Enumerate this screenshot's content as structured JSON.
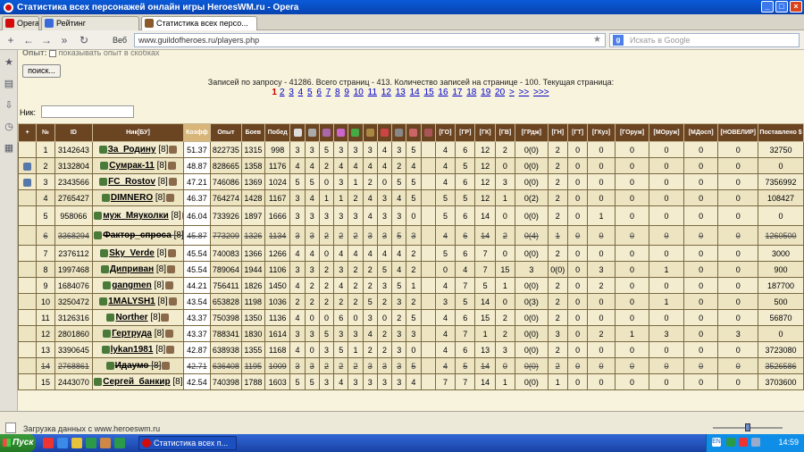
{
  "window": {
    "title": "Статистика всех персонажей онлайн игры HeroesWM.ru - Opera"
  },
  "tabs": [
    {
      "label": "Opera"
    },
    {
      "label": "Рейтинг"
    },
    {
      "label": "Статистика всех персо..."
    }
  ],
  "address": {
    "web_label": "Веб",
    "url": "www.guildofheroes.ru/players.php",
    "search_placeholder": "Искать в Google"
  },
  "page": {
    "option_label": "Опыт:",
    "option_hint": "показывать опыт в скобках",
    "search_button": "поиск...",
    "info": "Записей по запросу - 41286. Всего страниц - 413. Количество записей на странице - 100. Текущая страница:",
    "current_page": "1",
    "pages": [
      "2",
      "3",
      "4",
      "5",
      "6",
      "7",
      "8",
      "9",
      "10",
      "11",
      "12",
      "13",
      "14",
      "15",
      "16",
      "17",
      "18",
      "19",
      "20",
      ">",
      ">>",
      ">>>"
    ],
    "nick_label": "Ник:"
  },
  "table": {
    "headers": [
      "+",
      "№",
      "ID",
      "Ник[БУ]",
      "Коэфф",
      "Опыт",
      "Боев",
      "Побед",
      "",
      "",
      "",
      "",
      "",
      "",
      "",
      "",
      "",
      "",
      "[ГО]",
      "[ГР]",
      "[ГК]",
      "[ГВ]",
      "[ГРдж]",
      "[ГН]",
      "[ГТ]",
      "[ГКуз]",
      "[ГОруж]",
      "[МОруж]",
      "[МДосп]",
      "[НОВЕЛИР]",
      "Поставлено $"
    ],
    "rows": [
      {
        "n": "1",
        "id": "3142643",
        "nick": "За_Родину",
        "lvl": "[8]",
        "k": "51.37",
        "exp": "822735",
        "b": "1315",
        "w": "998",
        "s": [
          "3",
          "3",
          "5",
          "3",
          "3",
          "3",
          "4",
          "3",
          "5"
        ],
        "g": [
          "4",
          "6",
          "12",
          "2",
          "0(0)",
          "2",
          "0",
          "0",
          "0",
          "0",
          "0",
          "0"
        ],
        "p": "32750",
        "strike": false
      },
      {
        "n": "2",
        "id": "3132804",
        "nick": "Сумрак-11",
        "lvl": "[8]",
        "k": "48.87",
        "exp": "828665",
        "b": "1358",
        "w": "1176",
        "s": [
          "4",
          "4",
          "2",
          "4",
          "4",
          "4",
          "4",
          "2",
          "4"
        ],
        "g": [
          "4",
          "5",
          "12",
          "0",
          "0(0)",
          "2",
          "0",
          "0",
          "0",
          "0",
          "0",
          "0"
        ],
        "p": "0",
        "strike": false
      },
      {
        "n": "3",
        "id": "2343566",
        "nick": "FC_Rostov",
        "lvl": "[8]",
        "k": "47.21",
        "exp": "746086",
        "b": "1369",
        "w": "1024",
        "s": [
          "5",
          "5",
          "0",
          "3",
          "1",
          "2",
          "0",
          "5",
          "5"
        ],
        "g": [
          "4",
          "6",
          "12",
          "3",
          "0(0)",
          "2",
          "0",
          "0",
          "0",
          "0",
          "0",
          "0"
        ],
        "p": "7356992",
        "strike": false
      },
      {
        "n": "4",
        "id": "2765427",
        "nick": "DIMNERO",
        "lvl": "[8]",
        "k": "46.37",
        "exp": "764274",
        "b": "1428",
        "w": "1167",
        "s": [
          "3",
          "4",
          "1",
          "1",
          "2",
          "4",
          "3",
          "4",
          "5"
        ],
        "g": [
          "5",
          "5",
          "12",
          "1",
          "0(2)",
          "2",
          "0",
          "0",
          "0",
          "0",
          "0",
          "0"
        ],
        "p": "108427",
        "strike": false
      },
      {
        "n": "5",
        "id": "958066",
        "nick": "муж_Мяуколки",
        "lvl": "[8]",
        "k": "46.04",
        "exp": "733926",
        "b": "1897",
        "w": "1666",
        "s": [
          "3",
          "3",
          "3",
          "3",
          "3",
          "4",
          "3",
          "3",
          "0"
        ],
        "g": [
          "5",
          "6",
          "14",
          "0",
          "0(0)",
          "2",
          "0",
          "1",
          "0",
          "0",
          "0",
          "0"
        ],
        "p": "0",
        "strike": false
      },
      {
        "n": "6",
        "id": "3368294",
        "nick": "Фактор_спроса",
        "lvl": "[8]",
        "k": "45.87",
        "exp": "773209",
        "b": "1326",
        "w": "1134",
        "s": [
          "3",
          "3",
          "2",
          "2",
          "2",
          "3",
          "3",
          "5",
          "3"
        ],
        "g": [
          "4",
          "6",
          "14",
          "2",
          "0(4)",
          "1",
          "0",
          "0",
          "0",
          "0",
          "0",
          "0"
        ],
        "p": "1260500",
        "strike": true
      },
      {
        "n": "7",
        "id": "2376112",
        "nick": "Sky_Verde",
        "lvl": "[8]",
        "k": "45.54",
        "exp": "740083",
        "b": "1366",
        "w": "1266",
        "s": [
          "4",
          "4",
          "0",
          "4",
          "4",
          "4",
          "4",
          "4",
          "2"
        ],
        "g": [
          "5",
          "6",
          "7",
          "0",
          "0(0)",
          "2",
          "0",
          "0",
          "0",
          "0",
          "0",
          "0"
        ],
        "p": "3000",
        "strike": false
      },
      {
        "n": "8",
        "id": "1997468",
        "nick": "Диприван",
        "lvl": "[8]",
        "k": "45.54",
        "exp": "789064",
        "b": "1944",
        "w": "1106",
        "s": [
          "3",
          "3",
          "2",
          "3",
          "2",
          "2",
          "5",
          "4",
          "2"
        ],
        "g": [
          "0",
          "4",
          "7",
          "15",
          "3",
          "0(0)",
          "0",
          "3",
          "0",
          "1",
          "0",
          "0"
        ],
        "p": "900",
        "strike": false
      },
      {
        "n": "9",
        "id": "1684076",
        "nick": "gangmen",
        "lvl": "[8]",
        "k": "44.21",
        "exp": "756411",
        "b": "1826",
        "w": "1450",
        "s": [
          "4",
          "2",
          "2",
          "4",
          "2",
          "2",
          "3",
          "5",
          "1"
        ],
        "g": [
          "4",
          "7",
          "5",
          "1",
          "0(0)",
          "2",
          "0",
          "2",
          "0",
          "0",
          "0",
          "0"
        ],
        "p": "187700",
        "strike": false
      },
      {
        "n": "10",
        "id": "3250472",
        "nick": "1MALYSH1",
        "lvl": "[8]",
        "k": "43.54",
        "exp": "653828",
        "b": "1198",
        "w": "1036",
        "s": [
          "2",
          "2",
          "2",
          "2",
          "2",
          "5",
          "2",
          "3",
          "2"
        ],
        "g": [
          "3",
          "5",
          "14",
          "0",
          "0(3)",
          "2",
          "0",
          "0",
          "0",
          "1",
          "0",
          "0"
        ],
        "p": "500",
        "strike": false
      },
      {
        "n": "11",
        "id": "3126316",
        "nick": "Norther",
        "lvl": "[8]",
        "k": "43.37",
        "exp": "750398",
        "b": "1350",
        "w": "1136",
        "s": [
          "4",
          "0",
          "0",
          "6",
          "0",
          "3",
          "0",
          "2",
          "5"
        ],
        "g": [
          "4",
          "6",
          "15",
          "2",
          "0(0)",
          "2",
          "0",
          "0",
          "0",
          "0",
          "0",
          "0"
        ],
        "p": "56870",
        "strike": false
      },
      {
        "n": "12",
        "id": "2801860",
        "nick": "Гертруда",
        "lvl": "[8]",
        "k": "43.37",
        "exp": "788341",
        "b": "1830",
        "w": "1614",
        "s": [
          "3",
          "3",
          "5",
          "3",
          "3",
          "4",
          "2",
          "3",
          "3"
        ],
        "g": [
          "4",
          "7",
          "1",
          "2",
          "0(0)",
          "3",
          "0",
          "2",
          "1",
          "3",
          "0",
          "3"
        ],
        "p": "0",
        "strike": false
      },
      {
        "n": "13",
        "id": "3390645",
        "nick": "lykan1981",
        "lvl": "[8]",
        "k": "42.87",
        "exp": "638938",
        "b": "1355",
        "w": "1168",
        "s": [
          "4",
          "0",
          "3",
          "5",
          "1",
          "2",
          "2",
          "3",
          "0"
        ],
        "g": [
          "4",
          "6",
          "13",
          "3",
          "0(0)",
          "2",
          "0",
          "0",
          "0",
          "0",
          "0",
          "0"
        ],
        "p": "3723080",
        "strike": false
      },
      {
        "n": "14",
        "id": "2768861",
        "nick": "Идаумо",
        "lvl": "[8]",
        "k": "42.71",
        "exp": "636408",
        "b": "1195",
        "w": "1009",
        "s": [
          "3",
          "3",
          "2",
          "2",
          "2",
          "3",
          "3",
          "3",
          "5"
        ],
        "g": [
          "4",
          "5",
          "14",
          "0",
          "0(0)",
          "2",
          "0",
          "0",
          "0",
          "0",
          "0",
          "0"
        ],
        "p": "3526586",
        "strike": true
      },
      {
        "n": "15",
        "id": "2443070",
        "nick": "Сергей_банкир",
        "lvl": "[8]",
        "k": "42.54",
        "exp": "740398",
        "b": "1788",
        "w": "1603",
        "s": [
          "5",
          "5",
          "3",
          "4",
          "3",
          "3",
          "3",
          "3",
          "4"
        ],
        "g": [
          "7",
          "7",
          "14",
          "1",
          "0(0)",
          "1",
          "0",
          "0",
          "0",
          "0",
          "0",
          "0"
        ],
        "p": "3703600",
        "strike": false
      }
    ]
  },
  "status": {
    "message": "Загрузка данных с www.heroeswm.ru"
  },
  "taskbar": {
    "start": "Пуск",
    "task": "Статистика всех п...",
    "clock": "14:59",
    "lang": "EN"
  },
  "colors": {
    "header_bg": "#6b4422",
    "koef_header": "#d8b67a",
    "row_bg": "#f3eccf",
    "page_bg": "#f8f3dc",
    "link": "#0000cc"
  }
}
